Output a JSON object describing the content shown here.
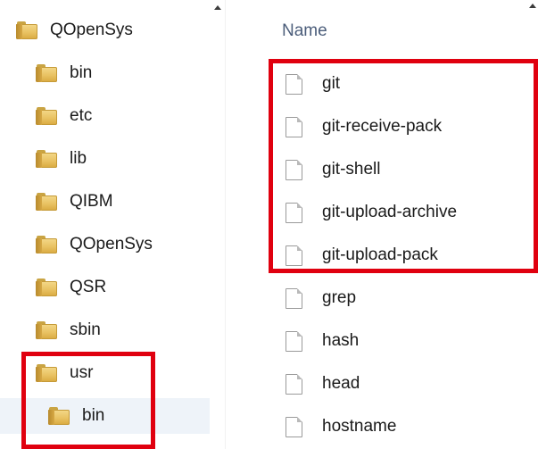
{
  "nav": {
    "items": [
      {
        "label": "QOpenSys",
        "icon": "folder-icon"
      },
      {
        "label": "bin",
        "icon": "folder-icon"
      },
      {
        "label": "etc",
        "icon": "folder-icon"
      },
      {
        "label": "lib",
        "icon": "folder-icon"
      },
      {
        "label": "QIBM",
        "icon": "folder-icon"
      },
      {
        "label": "QOpenSys",
        "icon": "folder-icon"
      },
      {
        "label": "QSR",
        "icon": "folder-icon"
      },
      {
        "label": "sbin",
        "icon": "folder-icon"
      },
      {
        "label": "usr",
        "icon": "folder-icon"
      },
      {
        "label": "bin",
        "icon": "folder-icon",
        "selected": true
      }
    ]
  },
  "file_list": {
    "column_header": "Name",
    "files": [
      {
        "name": "git",
        "icon": "file-icon",
        "highlighted": true
      },
      {
        "name": "git-receive-pack",
        "icon": "file-icon",
        "highlighted": true
      },
      {
        "name": "git-shell",
        "icon": "file-icon",
        "highlighted": true
      },
      {
        "name": "git-upload-archive",
        "icon": "file-icon",
        "highlighted": true
      },
      {
        "name": "git-upload-pack",
        "icon": "file-icon",
        "highlighted": true
      },
      {
        "name": "grep",
        "icon": "file-icon"
      },
      {
        "name": "hash",
        "icon": "file-icon"
      },
      {
        "name": "head",
        "icon": "file-icon"
      },
      {
        "name": "hostname",
        "icon": "file-icon"
      }
    ]
  },
  "colors": {
    "highlight": "#e0000f",
    "folder": "#e9c263",
    "selected_row": "#eef3f9",
    "header_text": "#4b5d7a"
  }
}
